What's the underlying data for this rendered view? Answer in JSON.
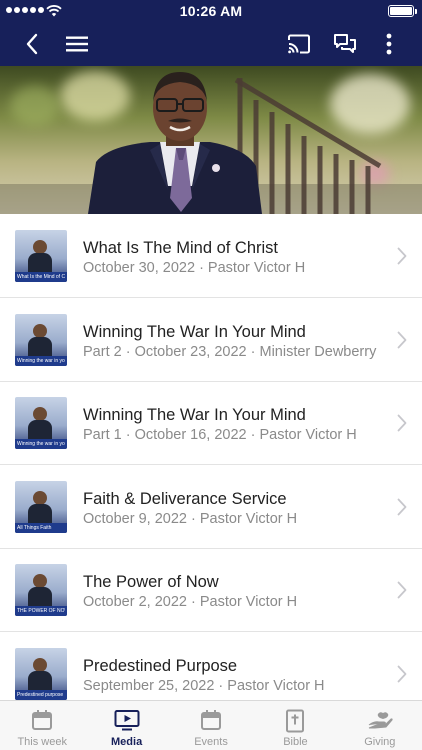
{
  "status_bar": {
    "time": "10:26 AM"
  },
  "colors": {
    "brand": "#17205a",
    "inactive": "#9a9a9a",
    "subtitle": "#8a8a8a"
  },
  "nav": {
    "icons": [
      "back-icon",
      "menu-icon",
      "cast-icon",
      "chat-icon",
      "more-icon"
    ]
  },
  "media": {
    "items": [
      {
        "title": "What Is The Mind of Christ",
        "subtitle": "October 30, 2022 · Pastor Victor H",
        "thumb_caption": "What Is the Mind of Christ"
      },
      {
        "title": "Winning The War In Your Mind",
        "subtitle": "Part 2 · October 23, 2022 · Minister Dewberry",
        "thumb_caption": "Winning the war in your mind"
      },
      {
        "title": "Winning The War In Your Mind",
        "subtitle": "Part 1 · October 16, 2022 · Pastor Victor H",
        "thumb_caption": "Winning the war in your mind"
      },
      {
        "title": "Faith & Deliverance Service",
        "subtitle": "October 9, 2022 · Pastor Victor H",
        "thumb_caption": "All Things Faith"
      },
      {
        "title": "The Power of Now",
        "subtitle": "October 2, 2022 · Pastor Victor H",
        "thumb_caption": "THE POWER OF NOW"
      },
      {
        "title": "Predestined Purpose",
        "subtitle": "September 25, 2022 · Pastor Victor H",
        "thumb_caption": "Predestined purpose"
      }
    ]
  },
  "tabs": [
    {
      "label": "This week",
      "icon": "calendar-icon",
      "active": false
    },
    {
      "label": "Media",
      "icon": "play-icon",
      "active": true
    },
    {
      "label": "Events",
      "icon": "calendar-icon",
      "active": false
    },
    {
      "label": "Bible",
      "icon": "bible-icon",
      "active": false
    },
    {
      "label": "Giving",
      "icon": "giving-hand-icon",
      "active": false
    }
  ]
}
